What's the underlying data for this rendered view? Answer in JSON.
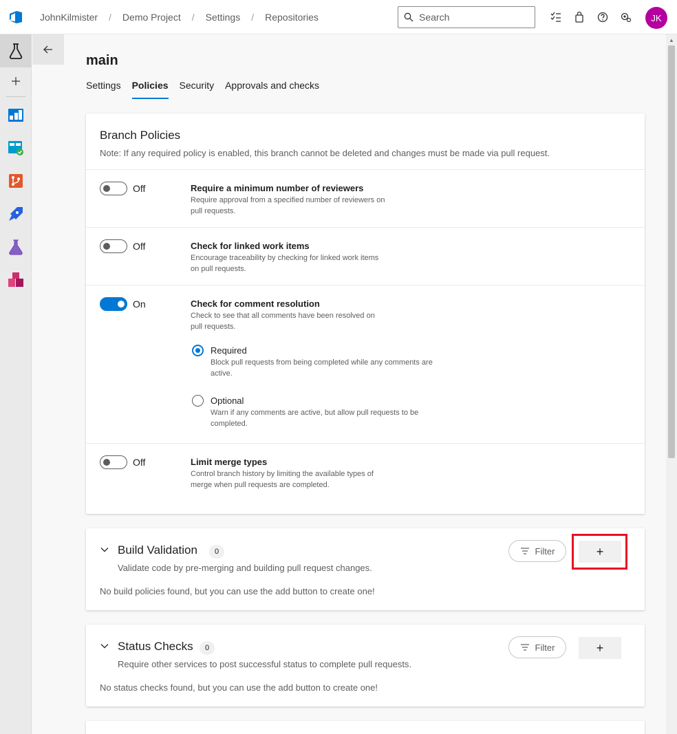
{
  "breadcrumb": [
    "JohnKilmister",
    "Demo Project",
    "Settings",
    "Repositories"
  ],
  "search": {
    "placeholder": "Search"
  },
  "avatar": {
    "initials": "JK",
    "color": "#b4009e"
  },
  "page": {
    "title": "main"
  },
  "tabs": [
    {
      "label": "Settings",
      "active": false
    },
    {
      "label": "Policies",
      "active": true
    },
    {
      "label": "Security",
      "active": false
    },
    {
      "label": "Approvals and checks",
      "active": false
    }
  ],
  "branch_policies": {
    "title": "Branch Policies",
    "note": "Note: If any required policy is enabled, this branch cannot be deleted and changes must be made via pull request.",
    "policies": [
      {
        "state": "Off",
        "title": "Require a minimum number of reviewers",
        "desc": "Require approval from a specified number of reviewers on pull requests."
      },
      {
        "state": "Off",
        "title": "Check for linked work items",
        "desc": "Encourage traceability by checking for linked work items on pull requests."
      },
      {
        "state": "On",
        "title": "Check for comment resolution",
        "desc": "Check to see that all comments have been resolved on pull requests.",
        "options": [
          {
            "label": "Required",
            "desc": "Block pull requests from being completed while any comments are active.",
            "selected": true
          },
          {
            "label": "Optional",
            "desc": "Warn if any comments are active, but allow pull requests to be completed.",
            "selected": false
          }
        ]
      },
      {
        "state": "Off",
        "title": "Limit merge types",
        "desc": "Control branch history by limiting the available types of merge when pull requests are completed."
      }
    ]
  },
  "build_validation": {
    "title": "Build Validation",
    "count": "0",
    "desc": "Validate code by pre-merging and building pull request changes.",
    "empty": "No build policies found, but you can use the add button to create one!",
    "filter_label": "Filter",
    "add_label": "+"
  },
  "status_checks": {
    "title": "Status Checks",
    "count": "0",
    "desc": "Require other services to post successful status to complete pull requests.",
    "empty": "No status checks found, but you can use the add button to create one!",
    "filter_label": "Filter",
    "add_label": "+"
  },
  "colors": {
    "accent": "#0078d4",
    "highlight": "#e81123"
  }
}
